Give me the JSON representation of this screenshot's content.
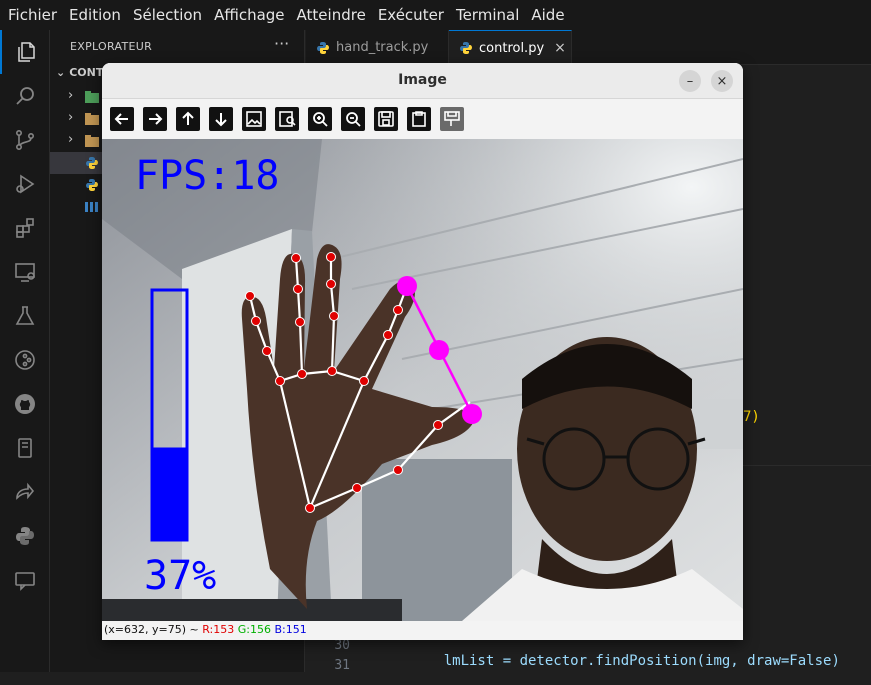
{
  "menu": [
    "Fichier",
    "Edition",
    "Sélection",
    "Affichage",
    "Atteindre",
    "Exécuter",
    "Terminal",
    "Aide"
  ],
  "sidebar": {
    "title": "EXPLORATEUR",
    "more": "···",
    "section": "CONT"
  },
  "tabs": [
    {
      "label": "hand_track.py"
    },
    {
      "label": "control.py",
      "close": "×"
    }
  ],
  "editor": {
    "fragment": "7)",
    "lines": [
      {
        "number": "30",
        "code": "lmList = detector.findPosition(img, draw=False)"
      },
      {
        "number": "31",
        "code": ""
      }
    ]
  },
  "image_window": {
    "title": "Image",
    "minimize": "–",
    "close": "×",
    "fps_text": "FPS:18",
    "volume_percent_text": "37%",
    "volume_level": 0.37,
    "toolbar_icons": [
      "arrow-left-icon",
      "arrow-right-icon",
      "arrow-up-icon",
      "arrow-down-icon",
      "image-icon",
      "image-search-icon",
      "zoom-in-icon",
      "zoom-out-icon",
      "save-icon",
      "clipboard-icon",
      "properties-icon"
    ],
    "status": {
      "coords": "(x=632, y=75) ~",
      "r": "R:153",
      "g": "G:156",
      "b": "B:151"
    }
  },
  "colors": {
    "accent": "#0078d4",
    "overlay_blue": "#0000ff",
    "overlay_magenta": "#ff00ff",
    "landmark_red": "#e00000",
    "python_yellow": "#ffd43b",
    "python_blue": "#3776ab"
  }
}
